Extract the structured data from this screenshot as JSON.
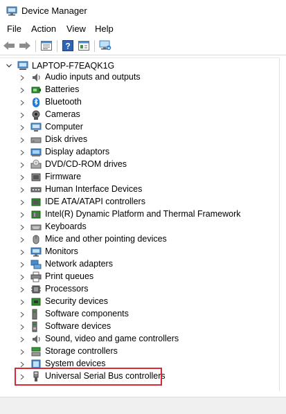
{
  "window": {
    "title": "Device Manager"
  },
  "menu": {
    "file": "File",
    "action": "Action",
    "view": "View",
    "help": "Help"
  },
  "toolbar": {
    "buttons": [
      "back-icon",
      "forward-icon",
      "properties-icon",
      "help-icon",
      "update-driver-icon",
      "scan-hardware-icon"
    ]
  },
  "tree": {
    "root": "LAPTOP-F7EAQK1G",
    "items": [
      {
        "label": "Audio inputs and outputs",
        "icon": "speaker-icon"
      },
      {
        "label": "Batteries",
        "icon": "battery-icon"
      },
      {
        "label": "Bluetooth",
        "icon": "bluetooth-icon"
      },
      {
        "label": "Cameras",
        "icon": "camera-icon"
      },
      {
        "label": "Computer",
        "icon": "computer-icon"
      },
      {
        "label": "Disk drives",
        "icon": "disk-drive-icon"
      },
      {
        "label": "Display adaptors",
        "icon": "display-adapter-icon"
      },
      {
        "label": "DVD/CD-ROM drives",
        "icon": "dvd-drive-icon"
      },
      {
        "label": "Firmware",
        "icon": "firmware-icon"
      },
      {
        "label": "Human Interface Devices",
        "icon": "hid-icon"
      },
      {
        "label": "IDE ATA/ATAPI controllers",
        "icon": "ide-controller-icon"
      },
      {
        "label": "Intel(R) Dynamic Platform and Thermal Framework",
        "icon": "thermal-framework-icon"
      },
      {
        "label": "Keyboards",
        "icon": "keyboard-icon"
      },
      {
        "label": "Mice and other pointing devices",
        "icon": "mouse-icon"
      },
      {
        "label": "Monitors",
        "icon": "monitor-icon"
      },
      {
        "label": "Network adapters",
        "icon": "network-adapter-icon"
      },
      {
        "label": "Print queues",
        "icon": "printer-icon"
      },
      {
        "label": "Processors",
        "icon": "processor-icon"
      },
      {
        "label": "Security devices",
        "icon": "security-device-icon"
      },
      {
        "label": "Software components",
        "icon": "software-component-icon"
      },
      {
        "label": "Software devices",
        "icon": "software-device-icon"
      },
      {
        "label": "Sound, video and game controllers",
        "icon": "sound-controller-icon"
      },
      {
        "label": "Storage controllers",
        "icon": "storage-controller-icon"
      },
      {
        "label": "System devices",
        "icon": "system-device-icon"
      },
      {
        "label": "Universal Serial Bus controllers",
        "icon": "usb-icon"
      }
    ]
  },
  "colors": {
    "highlight": "#d8282f",
    "accent": "#1e7ad6"
  }
}
